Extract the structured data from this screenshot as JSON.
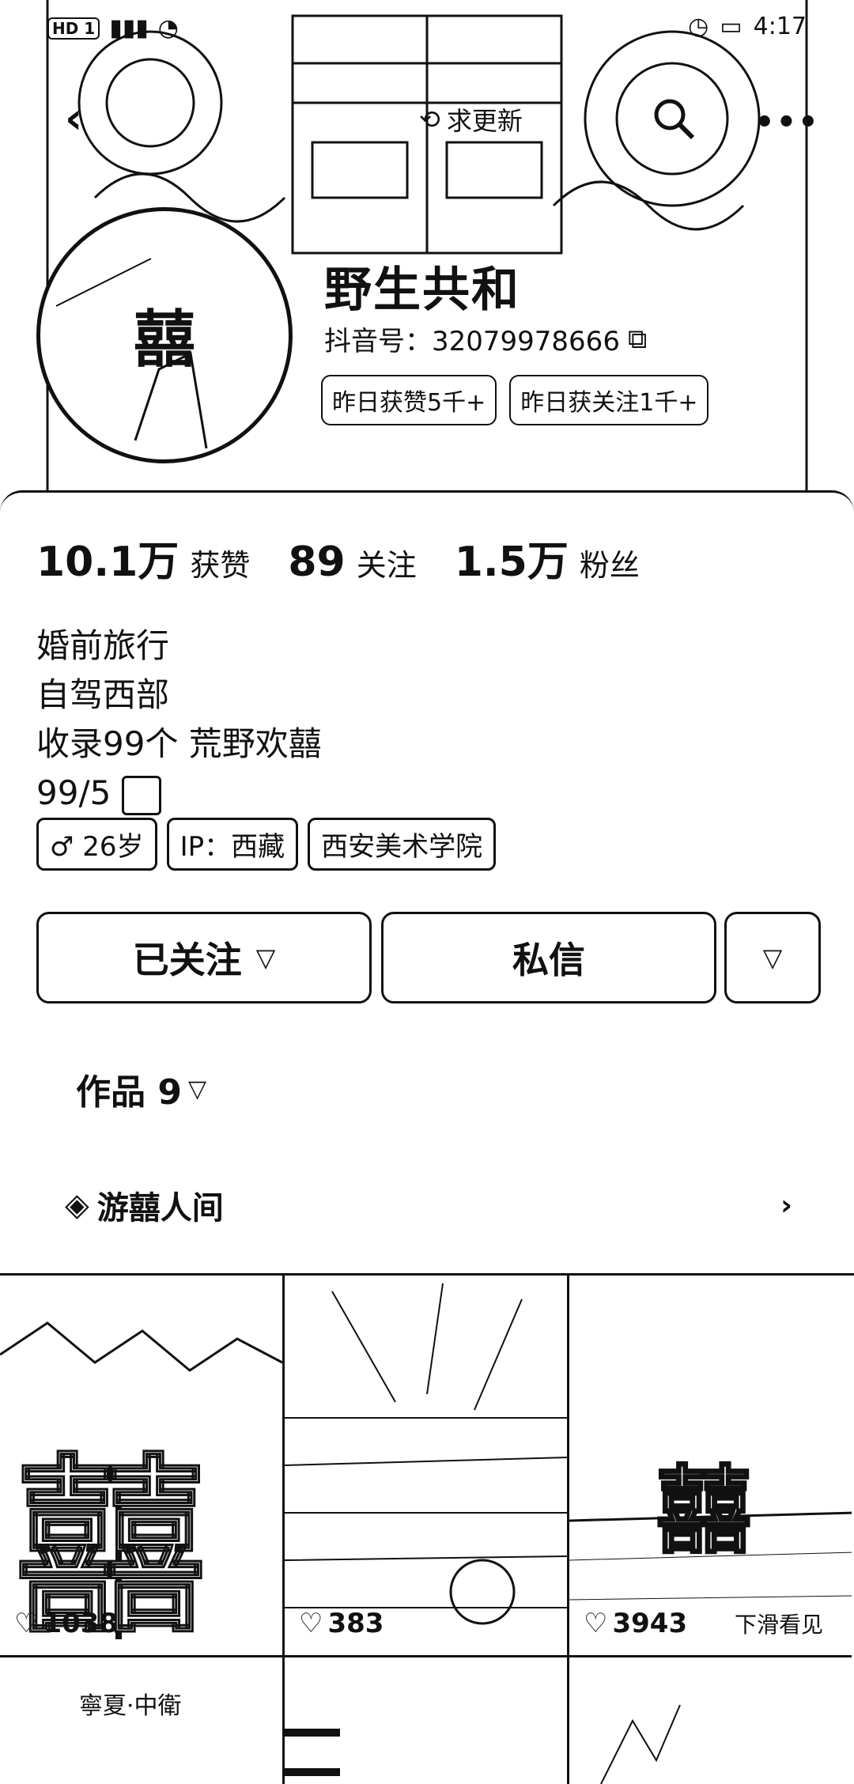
{
  "status_bar": {
    "left": "HD 1",
    "time": "4:17"
  },
  "header": {
    "update_label": "求更新",
    "more_label": "•••"
  },
  "profile": {
    "nickname": "野生共和",
    "douyin_id": "抖音号：32079978666",
    "badges": [
      "昨日获赞5千+",
      "昨日获关注1千+"
    ],
    "avatar_char": "囍"
  },
  "stats": [
    {
      "value": "10.1万",
      "label": "获赞"
    },
    {
      "value": "89",
      "label": "关注"
    },
    {
      "value": "1.5万",
      "label": "粉丝"
    }
  ],
  "bio": [
    "婚前旅行",
    "自驾西部",
    "收录99个 荒野欢囍",
    "99/5"
  ],
  "chips": [
    "26岁",
    "IP：西藏",
    "西安美术学院"
  ],
  "actions": {
    "followed": "已关注",
    "message": "私信"
  },
  "works": {
    "label": "作品 9"
  },
  "collection": {
    "label": "游囍人间"
  },
  "videos": [
    {
      "likes": "1038",
      "big": "囍"
    },
    {
      "likes": "383"
    },
    {
      "likes": "3943",
      "caption": "下滑看见",
      "big": "囍"
    }
  ],
  "row2": [
    {
      "caption": "寧夏·中衛"
    },
    {},
    {}
  ]
}
